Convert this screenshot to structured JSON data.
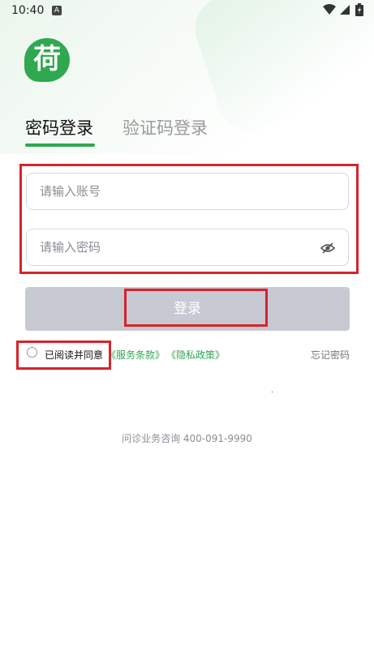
{
  "status_bar": {
    "time": "10:40",
    "sim_label": "A",
    "icons": [
      "sim-icon",
      "wifi-icon",
      "signal-icon",
      "battery-icon"
    ]
  },
  "logo": {
    "glyph": "荷",
    "color": "#2fa84f"
  },
  "tabs": [
    {
      "label": "密码登录",
      "active": true
    },
    {
      "label": "验证码登录",
      "active": false
    }
  ],
  "form": {
    "account_placeholder": "请输入账号",
    "account_value": "",
    "password_placeholder": "请输入密码",
    "password_value": "",
    "password_toggle_icon": "eye-off-icon"
  },
  "login_button": {
    "label": "登录",
    "enabled": false
  },
  "agreement": {
    "checked": false,
    "text": "已阅读并同意",
    "terms_link": "《服务条款》",
    "privacy_link": "《隐私政策》"
  },
  "forgot_password": "忘记密码",
  "hotline": "问诊业务咨询 400-091-9990",
  "colors": {
    "accent": "#2fa84f",
    "button_disabled": "#c7cad3",
    "highlight": "#d8232a"
  }
}
